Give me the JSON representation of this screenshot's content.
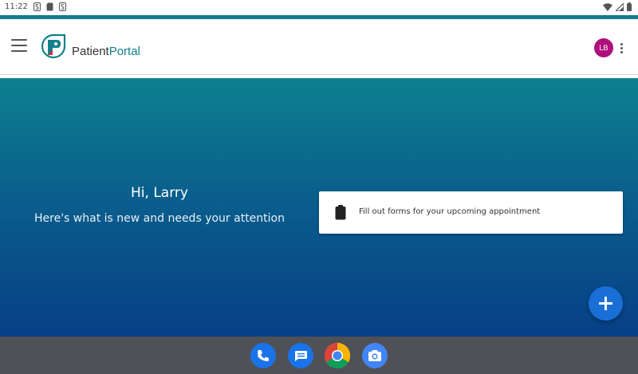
{
  "status_bar": {
    "time": "11:22",
    "notification_icons": [
      "s-icon",
      "sim-icon",
      "s-icon"
    ],
    "system_icons": [
      "wifi-icon",
      "signal-icon",
      "battery-icon"
    ]
  },
  "header": {
    "brand": {
      "part1": "Patient",
      "part2": "Portal"
    },
    "user_initials": "LB",
    "accent_color": "#137d8b"
  },
  "hero": {
    "greeting": "Hi, Larry",
    "subtitle": "Here's what is new and needs your attention",
    "task_card": {
      "icon": "clipboard-icon",
      "label": "Fill out forms for your upcoming appointment"
    }
  },
  "fab": {
    "icon": "plus-icon"
  },
  "taskbar": {
    "apps": [
      "phone-app-icon",
      "messages-app-icon",
      "chrome-app-icon",
      "camera-app-icon"
    ]
  }
}
